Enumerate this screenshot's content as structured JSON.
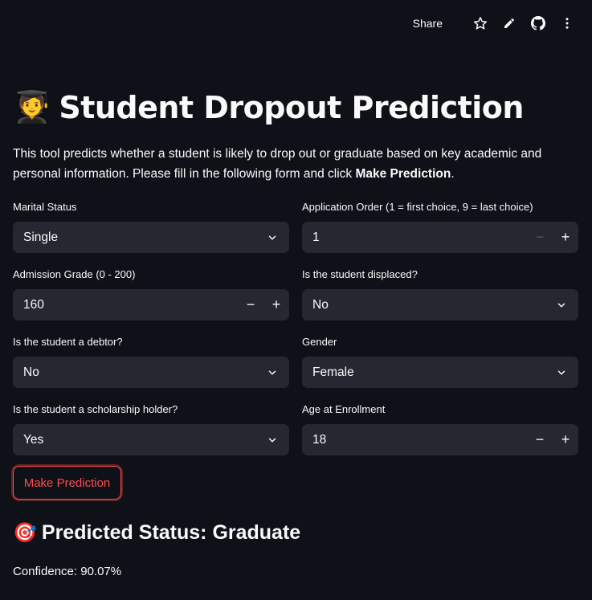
{
  "toolbar": {
    "share_label": "Share",
    "icons": [
      "star-icon",
      "pencil-icon",
      "github-icon",
      "more-vertical-icon"
    ]
  },
  "header": {
    "title_emoji": "🧑‍🎓",
    "title": "Student Dropout Prediction"
  },
  "intro": {
    "text": "This tool predicts whether a student is likely to drop out or graduate based on key academic and personal information. Please fill in the following form and click ",
    "bold": "Make Prediction",
    "end": "."
  },
  "form": {
    "marital_status": {
      "label": "Marital Status",
      "value": "Single"
    },
    "application_order": {
      "label": "Application Order (1 = first choice, 9 = last choice)",
      "value": "1"
    },
    "admission_grade": {
      "label": "Admission Grade (0 - 200)",
      "value": "160"
    },
    "displaced": {
      "label": "Is the student displaced?",
      "value": "No"
    },
    "debtor": {
      "label": "Is the student a debtor?",
      "value": "No"
    },
    "gender": {
      "label": "Gender",
      "value": "Female"
    },
    "scholarship": {
      "label": "Is the student a scholarship holder?",
      "value": "Yes"
    },
    "age": {
      "label": "Age at Enrollment",
      "value": "18"
    },
    "stepper_minus": "−",
    "stepper_plus": "+"
  },
  "actions": {
    "predict_label": "Make Prediction"
  },
  "result": {
    "emoji": "🎯",
    "status": "Predicted Status: Graduate",
    "confidence": "Confidence: 90.07%"
  },
  "colors": {
    "background": "#0e1117",
    "input_bg": "#262730",
    "accent": "#ff4b4b",
    "text": "#fafafa"
  }
}
